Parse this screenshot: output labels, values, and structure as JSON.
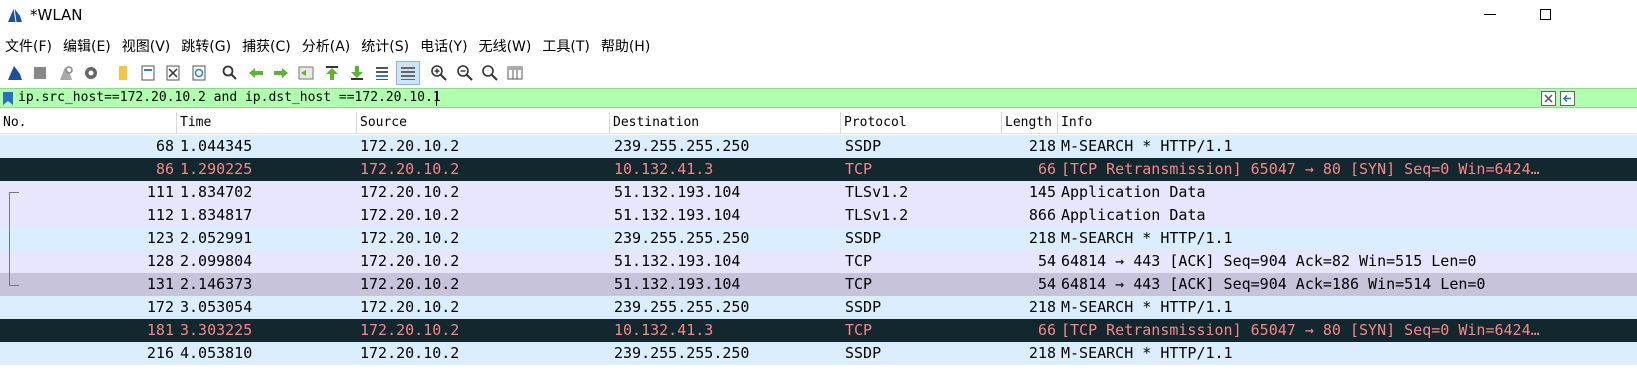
{
  "window": {
    "title": "*WLAN"
  },
  "menu": [
    "文件(F)",
    "编辑(E)",
    "视图(V)",
    "跳转(G)",
    "捕获(C)",
    "分析(A)",
    "统计(S)",
    "电话(Y)",
    "无线(W)",
    "工具(T)",
    "帮助(H)"
  ],
  "toolbar": {
    "icons": [
      "shark-fin-start-icon",
      "stop-icon",
      "restart-icon",
      "options-gear-icon",
      "open-folder-icon",
      "save-file-icon",
      "close-file-icon",
      "reload-icon",
      "find-magnifier-icon",
      "go-back-icon",
      "go-forward-icon",
      "go-to-packet-icon",
      "first-packet-icon",
      "last-packet-icon",
      "autoscroll-icon",
      "colorize-icon",
      "zoom-in-icon",
      "zoom-out-icon",
      "normal-size-icon",
      "resize-columns-icon"
    ]
  },
  "filter": {
    "value": "ip.src_host==172.20.10.2 and ip.dst_host ==172.20.10.1"
  },
  "columns": [
    "No.",
    "Time",
    "Source",
    "Destination",
    "Protocol",
    "Length",
    "Info"
  ],
  "colors": {
    "udp_row": "#daeeff",
    "tcp_row": "#e7e6ff",
    "tcp_selected": "#c6c3da",
    "bad_row_bg": "#12272e",
    "bad_row_fg": "#f78787"
  },
  "packets": [
    {
      "no": "68",
      "time": "1.044345",
      "src": "172.20.10.2",
      "dst": "239.255.255.250",
      "proto": "SSDP",
      "len": "218",
      "info": "M-SEARCH * HTTP/1.1",
      "style": "udp"
    },
    {
      "no": "86",
      "time": "1.290225",
      "src": "172.20.10.2",
      "dst": "10.132.41.3",
      "proto": "TCP",
      "len": "66",
      "info": "[TCP Retransmission] 65047 → 80 [SYN] Seq=0 Win=6424…",
      "style": "bad"
    },
    {
      "no": "111",
      "time": "1.834702",
      "src": "172.20.10.2",
      "dst": "51.132.193.104",
      "proto": "TLSv1.2",
      "len": "145",
      "info": "Application Data",
      "style": "tcp"
    },
    {
      "no": "112",
      "time": "1.834817",
      "src": "172.20.10.2",
      "dst": "51.132.193.104",
      "proto": "TLSv1.2",
      "len": "866",
      "info": "Application Data",
      "style": "tcp"
    },
    {
      "no": "123",
      "time": "2.052991",
      "src": "172.20.10.2",
      "dst": "239.255.255.250",
      "proto": "SSDP",
      "len": "218",
      "info": "M-SEARCH * HTTP/1.1",
      "style": "udp"
    },
    {
      "no": "128",
      "time": "2.099804",
      "src": "172.20.10.2",
      "dst": "51.132.193.104",
      "proto": "TCP",
      "len": "54",
      "info": "64814 → 443 [ACK] Seq=904 Ack=82 Win=515 Len=0",
      "style": "tcp"
    },
    {
      "no": "131",
      "time": "2.146373",
      "src": "172.20.10.2",
      "dst": "51.132.193.104",
      "proto": "TCP",
      "len": "54",
      "info": "64814 → 443 [ACK] Seq=904 Ack=186 Win=514 Len=0",
      "style": "selected"
    },
    {
      "no": "172",
      "time": "3.053054",
      "src": "172.20.10.2",
      "dst": "239.255.255.250",
      "proto": "SSDP",
      "len": "218",
      "info": "M-SEARCH * HTTP/1.1",
      "style": "udp"
    },
    {
      "no": "181",
      "time": "3.303225",
      "src": "172.20.10.2",
      "dst": "10.132.41.3",
      "proto": "TCP",
      "len": "66",
      "info": "[TCP Retransmission] 65047 → 80 [SYN] Seq=0 Win=6424…",
      "style": "bad"
    },
    {
      "no": "216",
      "time": "4.053810",
      "src": "172.20.10.2",
      "dst": "239.255.255.250",
      "proto": "SSDP",
      "len": "218",
      "info": "M-SEARCH * HTTP/1.1",
      "style": "udp"
    }
  ]
}
